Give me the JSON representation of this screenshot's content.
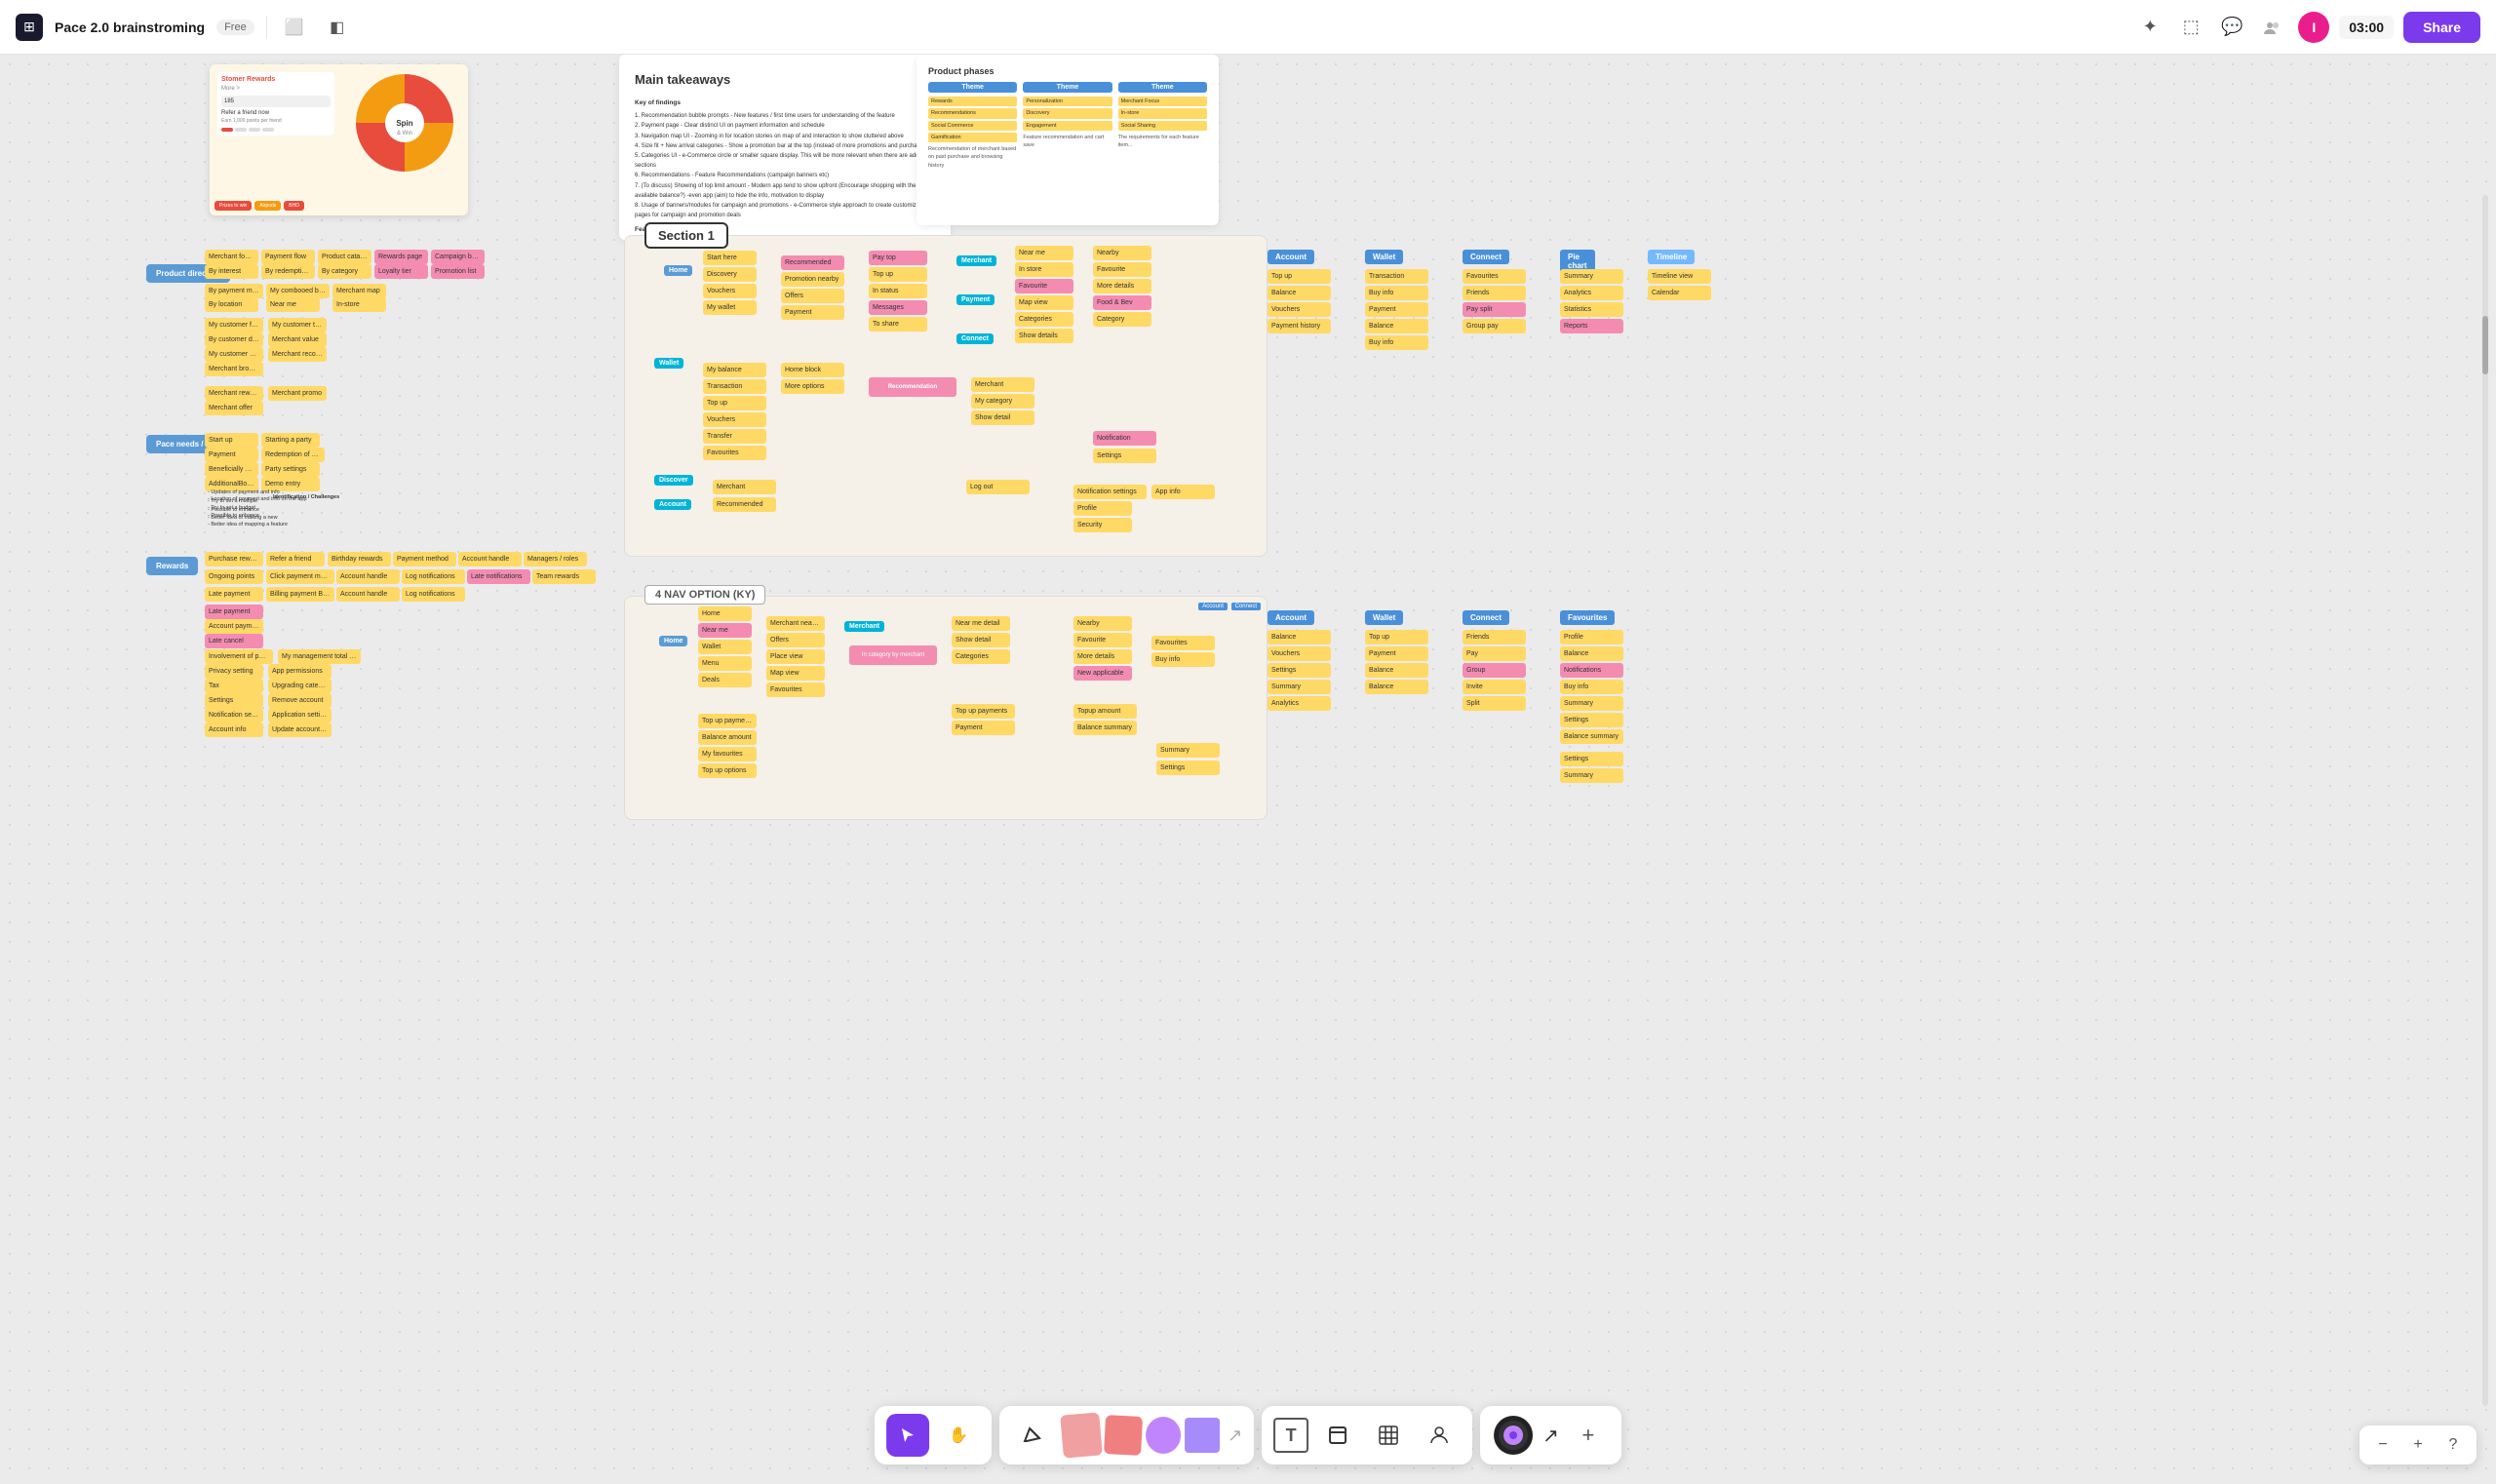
{
  "toolbar": {
    "logo_symbol": "⊞",
    "title": "Pace 2.0 brainstroming",
    "free_label": "Free",
    "timer": "03:00",
    "share_label": "Share",
    "avatar_initial": "I"
  },
  "canvas": {
    "section1_label": "Section 1",
    "nav_section_label": "4 NAV OPTION (KY)",
    "main_takeaways_title": "Main takeaways",
    "product_phases_title": "Product phases"
  },
  "bottom_toolbar": {
    "cursor_icon": "▶",
    "pen_icon": "✏",
    "shapes_icon": "◆",
    "circle_icon": "●",
    "rect_icon": "■",
    "text_icon": "T",
    "frame_icon": "⬜",
    "table_icon": "⊞",
    "person_icon": "👤",
    "camera_icon": "📷",
    "plus_icon": "+"
  },
  "zoom": {
    "minus_label": "−",
    "plus_label": "+",
    "help_label": "?"
  }
}
